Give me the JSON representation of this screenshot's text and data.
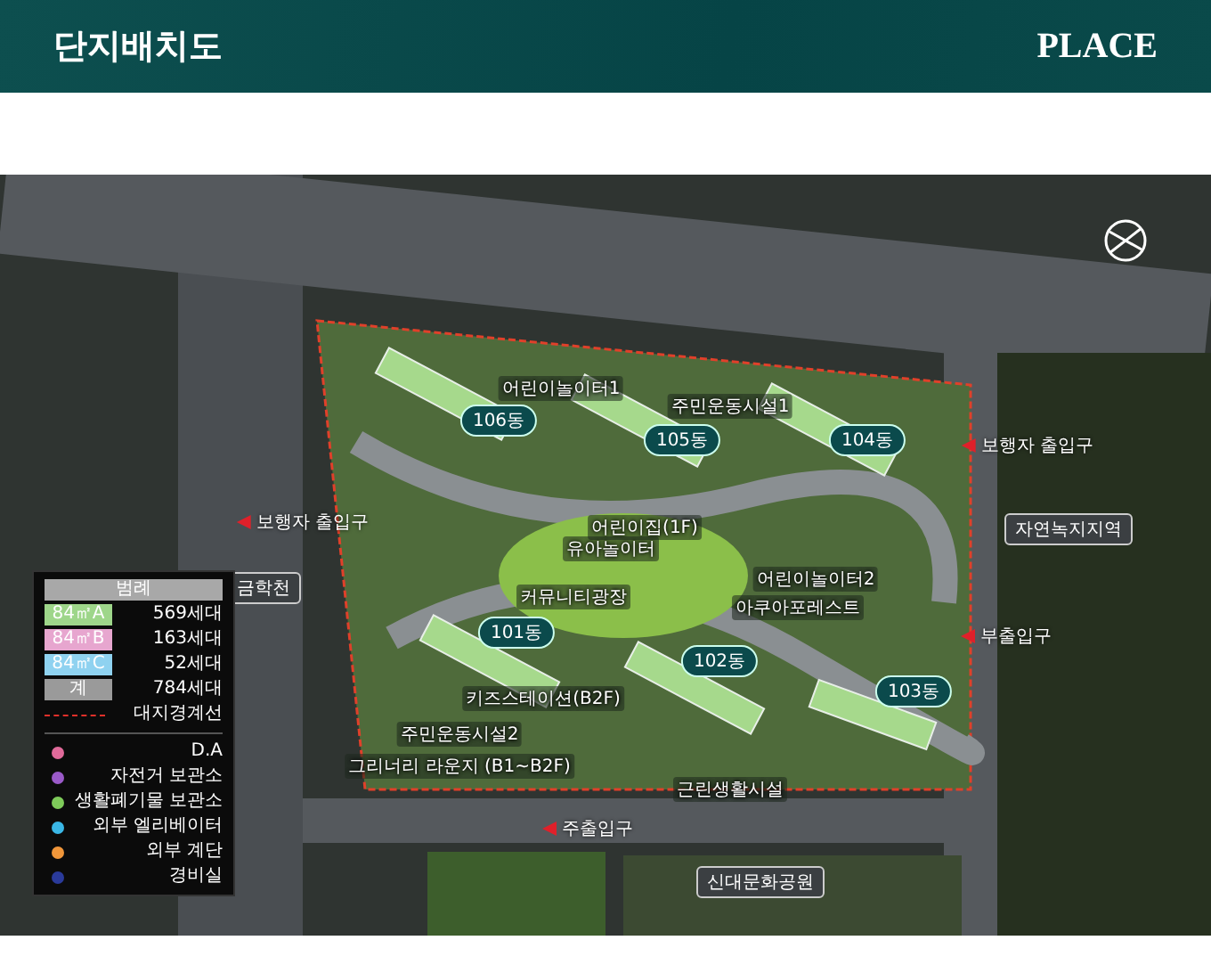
{
  "header": {
    "title": "단지배치도",
    "brand": "PLACE"
  },
  "site_plan": {
    "buildings": [
      {
        "label": "106동"
      },
      {
        "label": "105동"
      },
      {
        "label": "104동"
      },
      {
        "label": "101동"
      },
      {
        "label": "102동"
      },
      {
        "label": "103동"
      }
    ],
    "entrances": [
      "보행자 출입구",
      "보행자 출입구",
      "부출입구",
      "주출입구"
    ],
    "area_labels": [
      "금학천",
      "자연녹지지역",
      "신대문화공원"
    ],
    "facilities": [
      "어린이놀이터1",
      "주민운동시설1",
      "어린이집(1F)",
      "유아놀이터",
      "커뮤니티광장",
      "어린이놀이터2",
      "아쿠아포레스트",
      "키즈스테이션(B2F)",
      "주민운동시설2",
      "그리너리 라운지 (B1~B2F)",
      "근린생활시설"
    ]
  },
  "legend": {
    "title": "범례",
    "unit_types": [
      {
        "label": "84㎡A",
        "count": "569세대",
        "color": "#9ed68a"
      },
      {
        "label": "84㎡B",
        "count": "163세대",
        "color": "#e7a6cf"
      },
      {
        "label": "84㎡C",
        "count": "52세대",
        "color": "#8fd2f0"
      },
      {
        "label": "계",
        "count": "784세대",
        "color": "#9a9a9a"
      }
    ],
    "boundary": "대지경계선",
    "markers": [
      {
        "label": "D.A",
        "color": "#e06a9a"
      },
      {
        "label": "자전거 보관소",
        "color": "#9a5ac8"
      },
      {
        "label": "생활폐기물 보관소",
        "color": "#7ecb5a"
      },
      {
        "label": "외부 엘리베이터",
        "color": "#3ab7e6"
      },
      {
        "label": "외부 계단",
        "color": "#f0963a"
      },
      {
        "label": "경비실",
        "color": "#2a3a9a"
      }
    ]
  }
}
